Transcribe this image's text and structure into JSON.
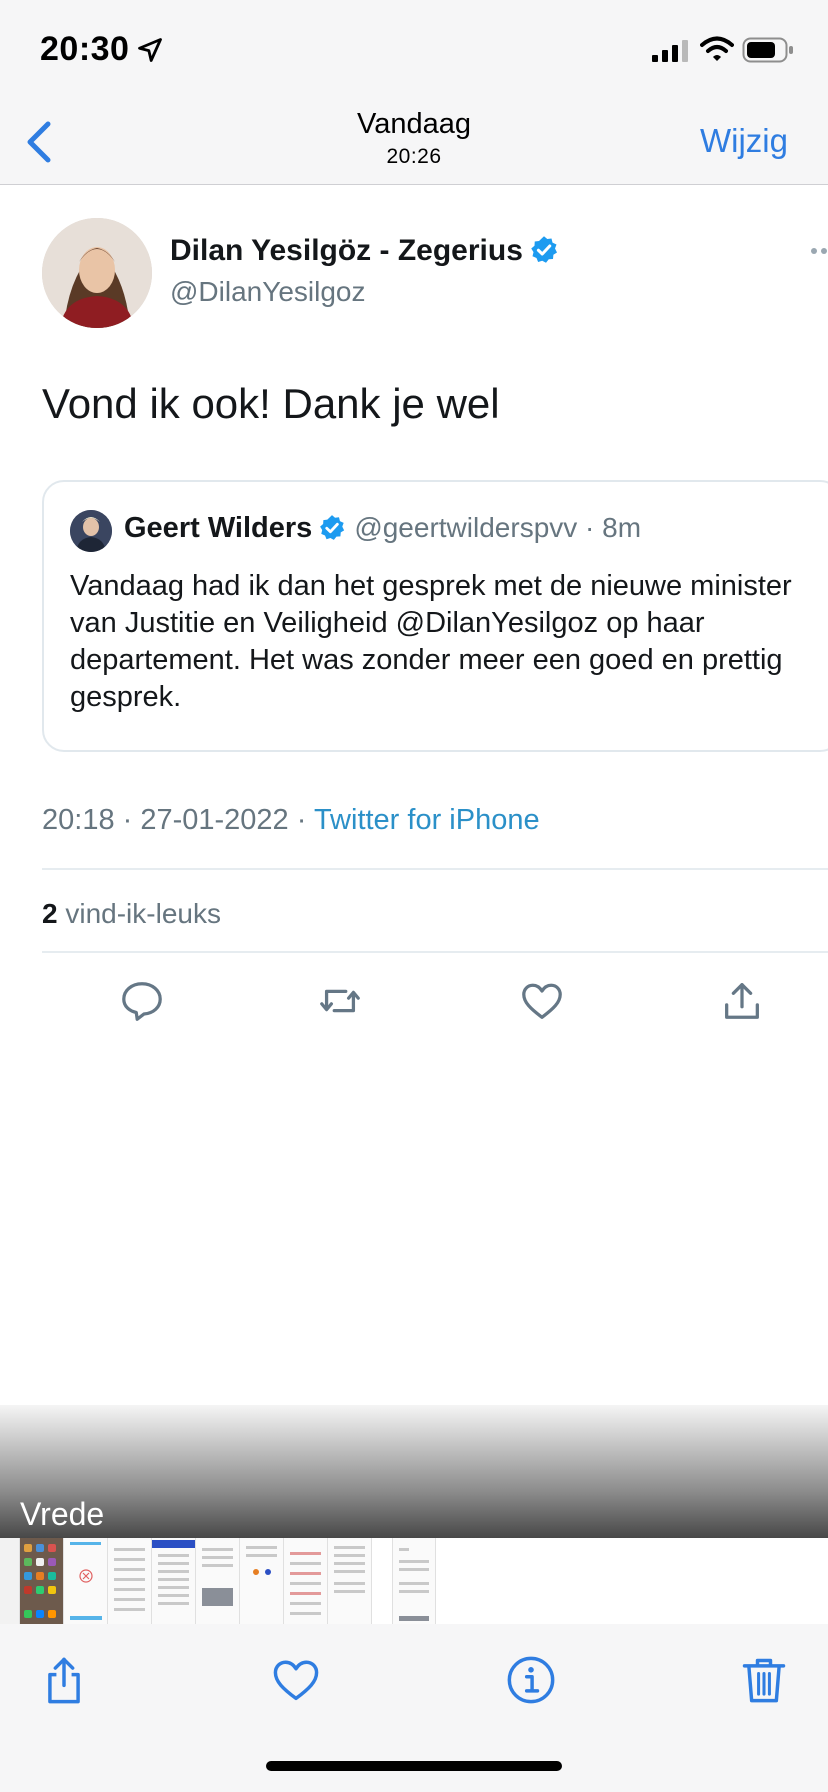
{
  "status_bar": {
    "time": "20:30",
    "icons": [
      "location-arrow-icon",
      "cellular-signal-icon",
      "wifi-icon",
      "battery-icon"
    ]
  },
  "nav": {
    "title": "Vandaag",
    "subtitle": "20:26",
    "edit_label": "Wijzig",
    "accent_color": "#2f7de1"
  },
  "tweet": {
    "author_name": "Dilan Yesilgöz - Zegerius",
    "author_handle": "@DilanYesilgoz",
    "text": "Vond ik ook! Dank je wel",
    "quote": {
      "author_name": "Geert Wilders",
      "author_handle": "@geertwilderspvv · 8m",
      "text": "Vandaag had ik dan het gesprek met de nieuwe minister van Justitie en Veiligheid @DilanYesilgoz op haar departement. Het was zonder meer een goed en prettig gesprek."
    },
    "time_date": "20:18 · 27-01-2022 · ",
    "source": "Twitter for iPhone",
    "likes_count": "2",
    "likes_label": " vind-ik-leuks",
    "actions": [
      "reply-icon",
      "retweet-icon",
      "like-icon",
      "share-icon"
    ],
    "verified_color": "#1d9bf0",
    "link_color": "#2b90c8"
  },
  "album": {
    "caption": "Vrede"
  },
  "toolbar": {
    "items": [
      "share-icon",
      "favorite-heart-icon",
      "info-icon",
      "trash-icon"
    ]
  }
}
